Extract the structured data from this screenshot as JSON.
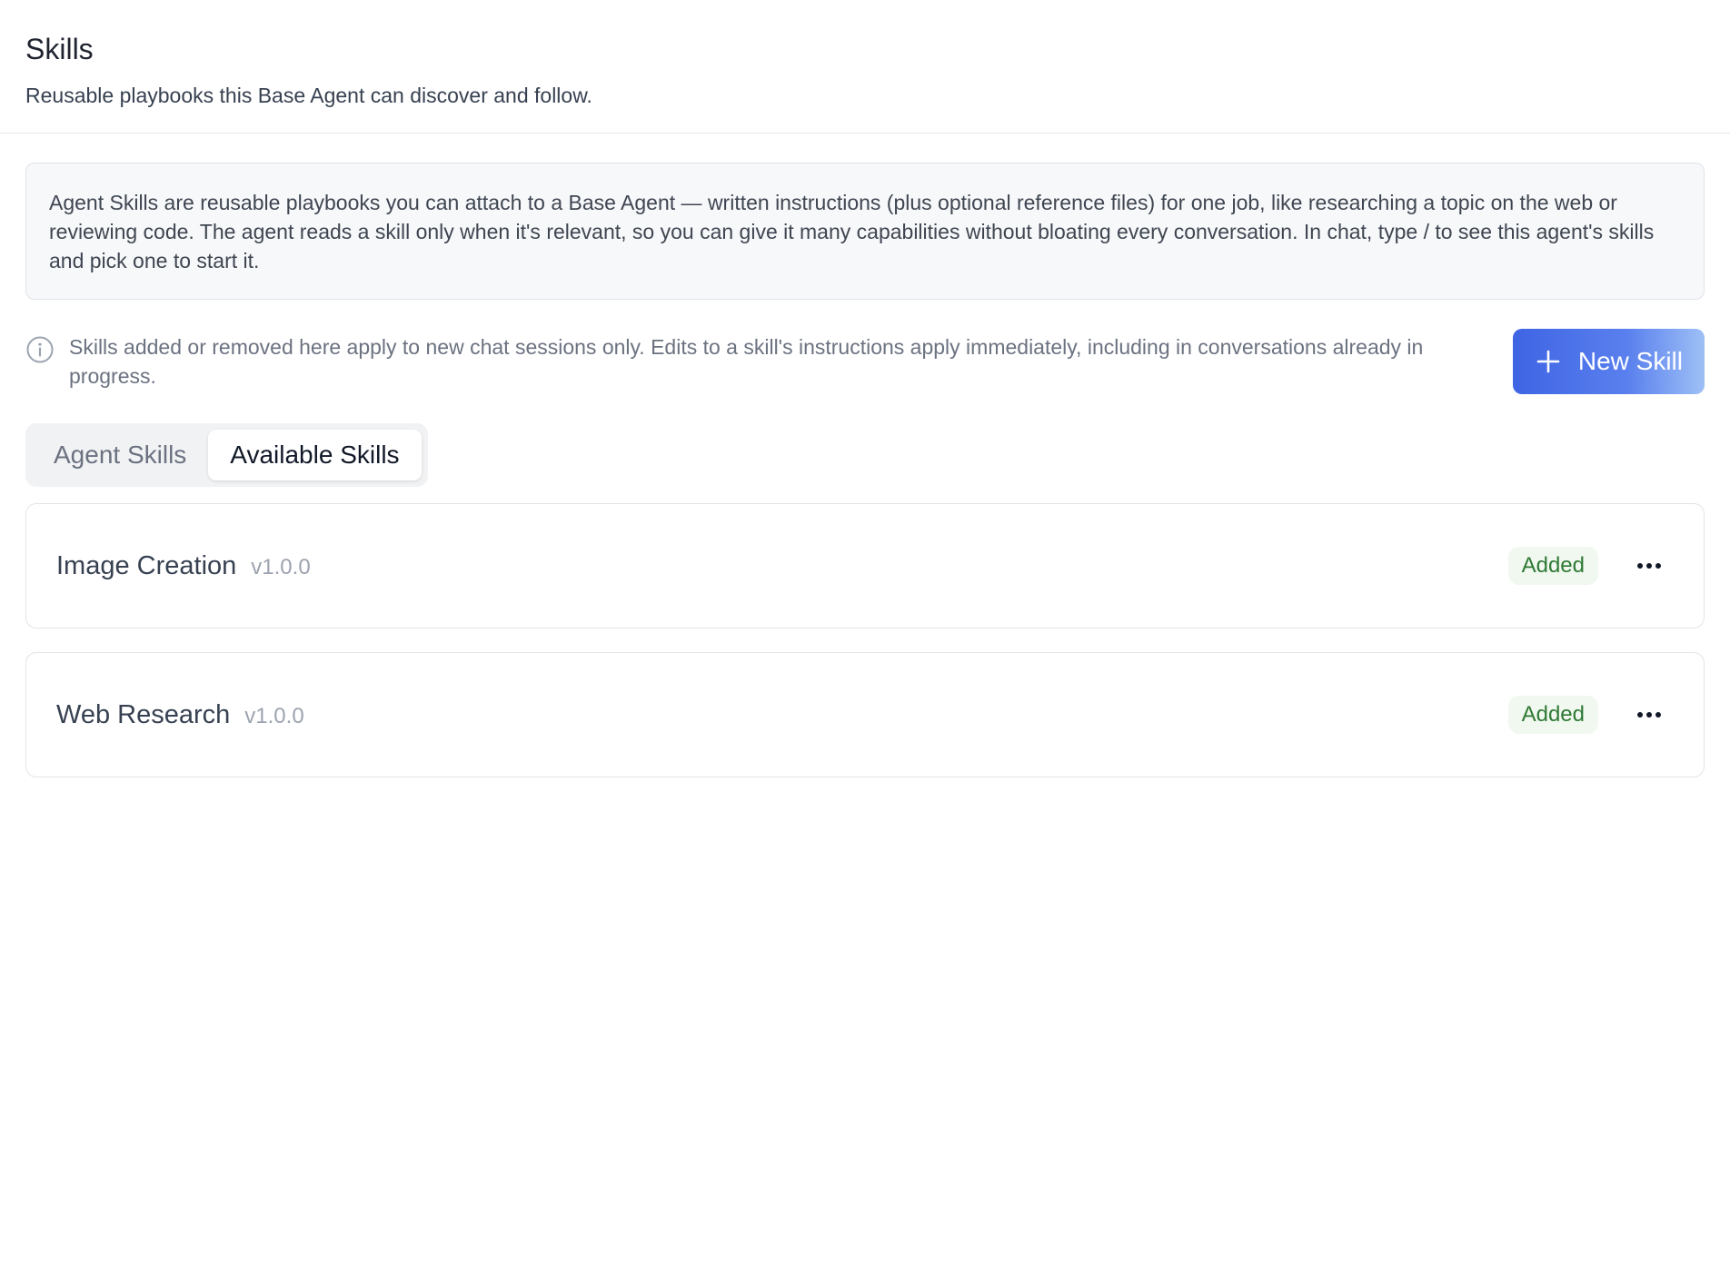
{
  "header": {
    "title": "Skills",
    "subtitle": "Reusable playbooks this Base Agent can discover and follow."
  },
  "info_box": {
    "text": "Agent Skills are reusable playbooks you can attach to a Base Agent — written instructions (plus optional reference files) for one job, like researching a topic on the web or reviewing code. The agent reads a skill only when it's relevant, so you can give it many capabilities without bloating every conversation. In chat, type / to see this agent's skills and pick one to start it."
  },
  "notice": {
    "icon": "info-icon",
    "text": "Skills added or removed here apply to new chat sessions only. Edits to a skill's instructions apply immediately, including in conversations already in progress."
  },
  "actions": {
    "new_skill_label": "New Skill",
    "new_skill_icon": "plus-icon",
    "accent_color": "#3f64e4"
  },
  "tabs": [
    {
      "label": "Agent Skills",
      "active": false
    },
    {
      "label": "Available Skills",
      "active": true
    }
  ],
  "skills": [
    {
      "name": "Image Creation",
      "version": "v1.0.0",
      "status": "Added",
      "menu_icon": "more-horizontal-icon"
    },
    {
      "name": "Web Research",
      "version": "v1.0.0",
      "status": "Added",
      "menu_icon": "more-horizontal-icon"
    }
  ],
  "colors": {
    "status_added_text": "#2f7a35",
    "status_added_bg": "#f0f8ef"
  }
}
